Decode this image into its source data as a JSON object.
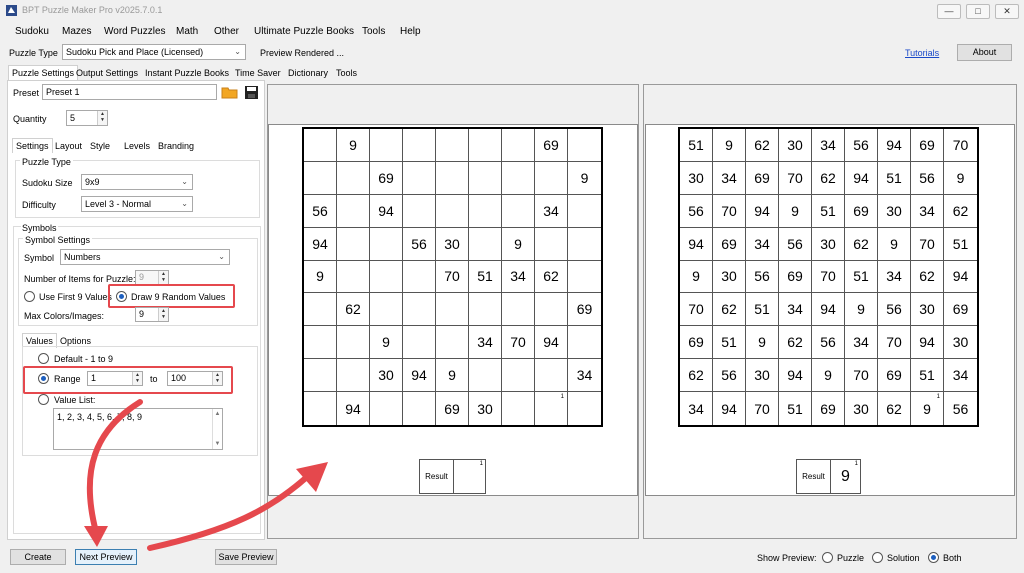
{
  "window": {
    "title": "BPT Puzzle Maker Pro v2025.7.0.1",
    "min": "—",
    "max": "□",
    "close": "✕"
  },
  "menu": [
    "Sudoku",
    "Mazes",
    "Word Puzzles",
    "Math",
    "Other",
    "Ultimate Puzzle Books",
    "Tools",
    "Help"
  ],
  "toolbar": {
    "puzzle_type_label": "Puzzle Type",
    "puzzle_type_value": "Sudoku Pick and Place (Licensed)",
    "status": "Preview Rendered ...",
    "tutorials": "Tutorials",
    "about": "About"
  },
  "main_tabs": [
    "Puzzle Settings",
    "Output Settings",
    "Instant Puzzle Books",
    "Time Saver",
    "Dictionary",
    "Tools"
  ],
  "preset": {
    "label": "Preset",
    "value": "Preset 1"
  },
  "quantity": {
    "label": "Quantity",
    "value": "5"
  },
  "settings_tabs": [
    "Settings",
    "Layout",
    "Style",
    "Levels",
    "Branding"
  ],
  "puzzle_type_group": {
    "title": "Puzzle Type",
    "size_label": "Sudoku Size",
    "size_value": "9x9",
    "difficulty_label": "Difficulty",
    "difficulty_value": "Level 3 - Normal"
  },
  "symbols": {
    "title": "Symbols",
    "settings_title": "Symbol Settings",
    "symbol_label": "Symbol",
    "symbol_value": "Numbers",
    "items_label": "Number of Items for Puzzle:",
    "items_value": "9",
    "use_first": "Use First 9 Values",
    "draw_random": "Draw 9 Random Values",
    "max_colors_label": "Max Colors/Images:",
    "max_colors_value": "9"
  },
  "value_tabs": [
    "Values",
    "Options"
  ],
  "values": {
    "default": "Default - 1 to 9",
    "range_label": "Range",
    "range_from": "1",
    "range_to_label": "to",
    "range_to": "100",
    "list_label": "Value List:",
    "list_value": "1, 2, 3, 4, 5, 6, 7, 8, 9"
  },
  "bottom": {
    "create": "Create",
    "next_preview": "Next Preview",
    "save_preview": "Save Preview",
    "show_preview_label": "Show Preview:",
    "opt_puzzle": "Puzzle",
    "opt_solution": "Solution",
    "opt_both": "Both"
  },
  "puzzle_grid": [
    [
      "",
      "9",
      "",
      "",
      "",
      "",
      "",
      "69",
      ""
    ],
    [
      "",
      "",
      "69",
      "",
      "",
      "",
      "",
      "",
      "9"
    ],
    [
      "56",
      "",
      "94",
      "",
      "",
      "",
      "",
      "34",
      ""
    ],
    [
      "94",
      "",
      "",
      "56",
      "30",
      "",
      "9",
      "",
      ""
    ],
    [
      "9",
      "",
      "",
      "",
      "70",
      "51",
      "34",
      "62",
      ""
    ],
    [
      "",
      "62",
      "",
      "",
      "",
      "",
      "",
      "",
      "69"
    ],
    [
      "",
      "",
      "9",
      "",
      "",
      "34",
      "70",
      "94",
      ""
    ],
    [
      "",
      "",
      "30",
      "94",
      "9",
      "",
      "",
      "",
      "34"
    ],
    [
      "",
      "94",
      "",
      "",
      "69",
      "30",
      "",
      "",
      ""
    ]
  ],
  "solution_grid": [
    [
      "51",
      "9",
      "62",
      "30",
      "34",
      "56",
      "94",
      "69",
      "70"
    ],
    [
      "30",
      "34",
      "69",
      "70",
      "62",
      "94",
      "51",
      "56",
      "9"
    ],
    [
      "56",
      "70",
      "94",
      "9",
      "51",
      "69",
      "30",
      "34",
      "62"
    ],
    [
      "94",
      "69",
      "34",
      "56",
      "30",
      "62",
      "9",
      "70",
      "51"
    ],
    [
      "9",
      "30",
      "56",
      "69",
      "70",
      "51",
      "34",
      "62",
      "94"
    ],
    [
      "70",
      "62",
      "51",
      "34",
      "94",
      "9",
      "56",
      "30",
      "69"
    ],
    [
      "69",
      "51",
      "9",
      "62",
      "56",
      "34",
      "70",
      "94",
      "30"
    ],
    [
      "62",
      "56",
      "30",
      "94",
      "9",
      "70",
      "69",
      "51",
      "34"
    ],
    [
      "34",
      "94",
      "70",
      "51",
      "69",
      "30",
      "62",
      "9",
      "56"
    ]
  ],
  "marker": "1",
  "result": {
    "label": "Result",
    "puzzle_value": "",
    "solution_value": "9",
    "marker": "1"
  },
  "colors": {
    "accent": "#1d5fbf",
    "highlight": "#e5484d"
  }
}
